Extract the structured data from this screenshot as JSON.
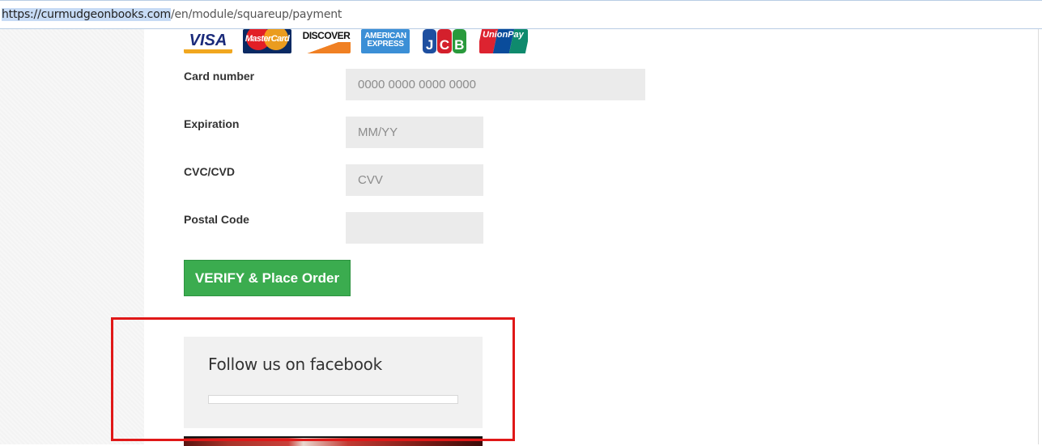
{
  "browser": {
    "url_highlighted": "https://curmudgeonbooks.com",
    "url_rest": "/en/module/squareup/payment"
  },
  "payment": {
    "card_brands": [
      "visa-logo",
      "mastercard-logo",
      "discover-logo",
      "american-express-logo",
      "jcb-logo",
      "unionpay-logo"
    ],
    "card_logo_text": {
      "visa": "VISA",
      "mastercard": "MasterCard",
      "discover": "DISCOVER",
      "amex_line1": "AMERICAN",
      "amex_line2": "EXPRESS",
      "jcb": [
        "J",
        "C",
        "B"
      ],
      "unionpay": "UnionPay"
    },
    "fields": {
      "card_number": {
        "label": "Card number",
        "placeholder": "0000 0000 0000 0000",
        "value": ""
      },
      "expiration": {
        "label": "Expiration",
        "placeholder": "MM/YY",
        "value": ""
      },
      "cvc": {
        "label": "CVC/CVD",
        "placeholder": "CVV",
        "value": ""
      },
      "postal": {
        "label": "Postal Code",
        "placeholder": "",
        "value": ""
      }
    },
    "submit_label": "VERIFY & Place Order"
  },
  "sidebar_widget": {
    "title": "Follow us on facebook"
  },
  "colors": {
    "button_green": "#3bac4f",
    "annotation_red": "#e01818",
    "input_bg": "#ebebeb"
  }
}
